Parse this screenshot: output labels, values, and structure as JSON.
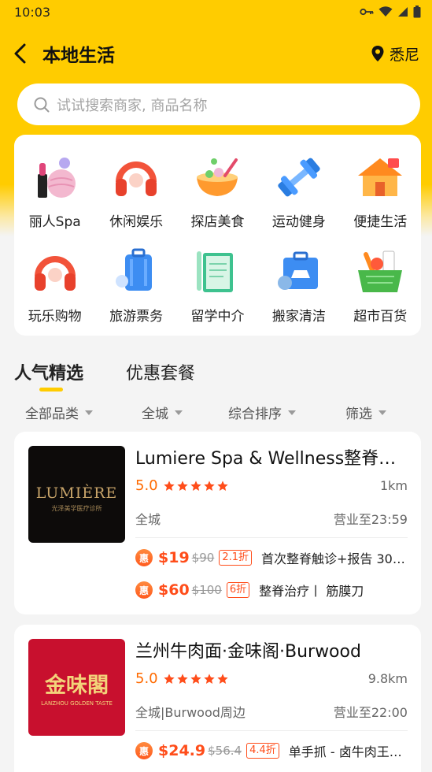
{
  "status_bar": {
    "time": "10:03"
  },
  "header": {
    "title": "本地生活",
    "location": "悉尼"
  },
  "search": {
    "placeholder": "试试搜索商家, 商品名称"
  },
  "categories": [
    {
      "label": "丽人Spa",
      "icon": "spa-icon"
    },
    {
      "label": "休闲娱乐",
      "icon": "headphones-icon"
    },
    {
      "label": "探店美食",
      "icon": "food-bowl-icon"
    },
    {
      "label": "运动健身",
      "icon": "dumbbell-icon"
    },
    {
      "label": "便捷生活",
      "icon": "house-icon"
    },
    {
      "label": "玩乐购物",
      "icon": "headphones-icon"
    },
    {
      "label": "旅游票务",
      "icon": "suitcase-icon"
    },
    {
      "label": "留学中介",
      "icon": "notebook-icon"
    },
    {
      "label": "搬家清洁",
      "icon": "moving-van-icon"
    },
    {
      "label": "超市百货",
      "icon": "grocery-basket-icon"
    }
  ],
  "tabs": [
    {
      "label": "人气精选",
      "active": true
    },
    {
      "label": "优惠套餐",
      "active": false
    }
  ],
  "filters": [
    {
      "label": "全部品类"
    },
    {
      "label": "全城"
    },
    {
      "label": "综合排序"
    },
    {
      "label": "筛选"
    }
  ],
  "shops": [
    {
      "name": "Lumiere Spa & Wellness整脊美…",
      "image_title": "LUMIÈRE",
      "image_subtitle": "光泽美学医疗诊所",
      "rating": "5.0",
      "stars": 5,
      "distance": "1km",
      "area": "全城",
      "hours": "营业至23:59",
      "deals": [
        {
          "badge": "惠",
          "price": "$19",
          "original": "$90",
          "discount": "2.1折",
          "desc": "首次整脊触诊+报告 30…"
        },
        {
          "badge": "惠",
          "price": "$60",
          "original": "$100",
          "discount": "6折",
          "desc": "整脊治疗丨 筋膜刀"
        }
      ]
    },
    {
      "name": "兰州牛肉面·金味阁·Burwood",
      "image_title": "金味閣",
      "image_subtitle": "LANZHOU GOLDEN TASTE",
      "rating": "5.0",
      "stars": 5,
      "distance": "9.8km",
      "area": "全城|Burwood周边",
      "hours": "营业至22:00",
      "deals": [
        {
          "badge": "惠",
          "price": "$24.9",
          "original": "$56.4",
          "discount": "4.4折",
          "desc": "单手抓 - 卤牛肉王…"
        }
      ]
    }
  ],
  "colors": {
    "brand_yellow": "#ffcc00",
    "price_orange": "#ff4d1a",
    "rating_orange": "#ff6a00"
  }
}
